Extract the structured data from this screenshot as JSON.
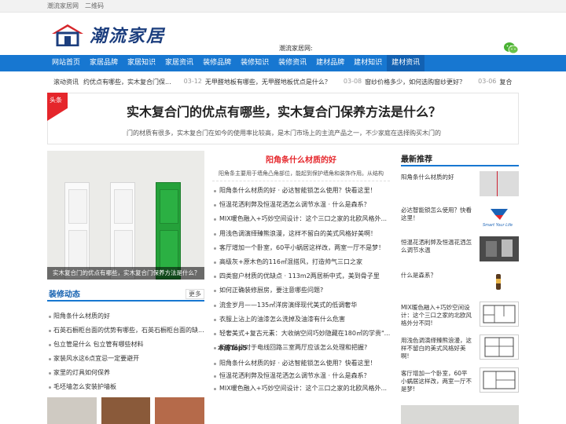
{
  "topbar": {
    "site_name": "潮流家居网",
    "qrcode": "二维码"
  },
  "header": {
    "logo_text": "潮流家居",
    "mid_label": "潮流家居网:",
    "wechat_icon": "wechat-icon"
  },
  "nav": [
    "网站首页",
    "家居品牌",
    "家居知识",
    "家居资讯",
    "装修品牌",
    "装修知识",
    "装修资讯",
    "建材品牌",
    "建材知识",
    "建材资讯"
  ],
  "ticker": {
    "label": "滚动资讯",
    "items": [
      {
        "title": "约优点有哪些，实木复合门保...",
        "date": "03-12"
      },
      {
        "title": "无甲醛地板有哪些，无甲醛地板优点是什么？",
        "date": "03-08"
      },
      {
        "title": "窗纱价格多少，如何选购窗纱更好？",
        "date": "03-06"
      },
      {
        "title": "复合",
        "date": ""
      }
    ]
  },
  "headline": {
    "badge": "头条",
    "title": "实木复合门的优点有哪些，实木复合门保养方法是什么？",
    "desc": "门的材质有很多，实木复合门在如今的使用率比较高，是木门市场上的主流产品之一，不少家庭在选择购买木门的"
  },
  "feature": {
    "caption": "实木复合门的优点有哪些，实木复合门保养方法是什么？"
  },
  "decoration": {
    "head": "装修动态",
    "more": "更多",
    "items": [
      "阳角条什么材质的好",
      "石英石橱柜台面的优势有哪些，石英石橱柜台面的缺...",
      "包立管是什么 包立管有哪些材料",
      "家装风水这6点宜忌一定要避开",
      "家里的灯具如何保养",
      "毛坯墙怎么安装护墙板"
    ]
  },
  "middle": {
    "title": "阳角条什么材质的好",
    "sub": "阳角条主要用于墙角凸角部位，能起到保护墙角和装饰作用。从结构",
    "items": [
      "阳角条什么材质的好 · 必达智能锁怎么使用？快看这里！",
      "恒温花洒利弊及恒温花洒怎么调节水温 · 什么是森系？",
      "MIX暖色融入+巧妙空间设计：这个三口之家的北欧风格外...",
      "用浅色调演绎臻熊浪漫，这样不留白的美式风格好美啊！",
      "客厅增加一个卧室，60平小蜗居这样改，两室一厅不是梦！",
      "高级灰+原木色的116㎡混搭风，打造帅气三口之家",
      "四类窗户材质的优缺点 · 113m2两居新中式，美到骨子里",
      "如何正确装修厨房，要注意哪些问题?",
      "流金岁月——135㎡洋房演绎现代美式的低调奢华",
      "衣服上沾上的油漆怎么洗掉及油漆有什么危害",
      "轻奢美式+复古元素：大收纳空间巧妙隐藏在180㎡的学贵\"...",
      "新家装修对于电线回路三室两厅应该怎么处理和把握?"
    ],
    "top5_title": "本周Top5",
    "top5": [
      "阳角条什么材质的好 · 必达智能锁怎么使用？快看这里！",
      "恒温花洒利弊及恒温花洒怎么调节水温 · 什么是森系？",
      "MIX暖色融入+巧妙空间设计：这个三口之家的北欧风格外..."
    ]
  },
  "recommend": {
    "head": "最新推荐",
    "items": [
      {
        "title": "阳角条什么材质的好",
        "thumb_label": ""
      },
      {
        "title": "必达智能锁怎么使用？快看这里！",
        "thumb_label": "Smart Your Life"
      },
      {
        "title": "恒温花洒利弊及恒温花洒怎么调节水温",
        "thumb_label": ""
      },
      {
        "title": "什么是森系？",
        "thumb_label": ""
      },
      {
        "title": "MIX暖色融入+巧妙空间设计：这个三口之家的北欧风格外分不同!",
        "thumb_label": ""
      },
      {
        "title": "用浅色调演绎臻熊浪漫，这样不留白的美式风格好美啊!",
        "thumb_label": ""
      },
      {
        "title": "客厅增加一个卧室，60平小蜗居这样改，两室一厅不是梦!",
        "thumb_label": ""
      }
    ]
  },
  "colors": {
    "primary": "#1777d1",
    "accent": "#e5262b",
    "logo": "#1c3e7e"
  }
}
